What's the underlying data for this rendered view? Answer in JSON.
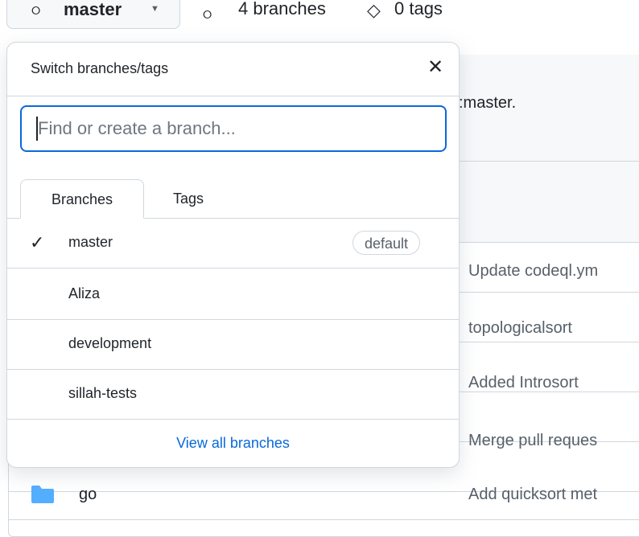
{
  "topbar": {
    "branch_icon": "git-branch-icon",
    "branch_name": "master",
    "caret_icon": "chevron-down-icon",
    "branches_icon": "git-branch-icon",
    "branches_count": "4 branches",
    "tags_icon": "tag-icon",
    "tags_count": "0 tags"
  },
  "background": {
    "notice_text": ":master.",
    "commit_messages": [
      "Update codeql.ym",
      "topologicalsort",
      "Added Introsort",
      "Merge pull reques",
      "Add quicksort met"
    ],
    "file_row": {
      "icon": "folder-icon",
      "name": "go"
    }
  },
  "dropdown": {
    "title": "Switch branches/tags",
    "close_icon": "close-icon",
    "filter_placeholder": "Find or create a branch...",
    "tabs": [
      {
        "label": "Branches",
        "active": true
      },
      {
        "label": "Tags",
        "active": false
      }
    ],
    "items": [
      {
        "label": "master",
        "selected": true,
        "check_icon": "check-icon",
        "badge": "default"
      },
      {
        "label": "Aliza",
        "selected": false
      },
      {
        "label": "development",
        "selected": false
      },
      {
        "label": "sillah-tests",
        "selected": false
      }
    ],
    "footer_link": "View all branches"
  },
  "colors": {
    "accent": "#0969da",
    "border": "#d0d7de",
    "folder": "#54aeff"
  }
}
